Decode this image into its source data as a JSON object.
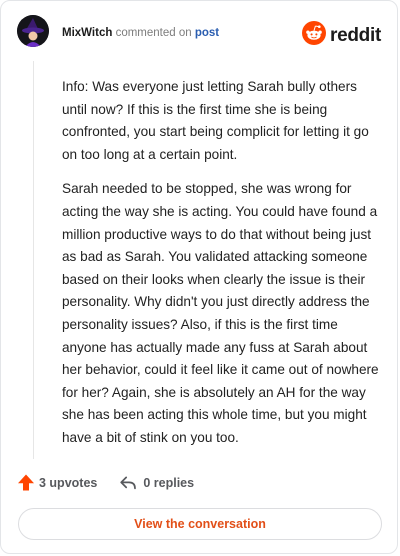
{
  "comment": {
    "username": "MixWitch",
    "action_text": "commented on",
    "target_link": "post",
    "avatar_icon": "witch-hat-avatar-icon",
    "paragraphs": [
      "Info: Was everyone just letting Sarah bully others until now? If this is the first time she is being confronted, you start being complicit for letting it go on too long at a certain point.",
      "Sarah needed to be stopped, she was wrong for acting the way she is acting. You could have found a million productive ways to do that without being just as bad as Sarah. You validated attacking someone based on their looks when clearly the issue is their personality. Why didn't you just directly address the personality issues? Also, if this is the first time anyone has actually made any fuss at Sarah about her behavior, could it feel like it came out of nowhere for her? Again, she is absolutely an AH for the way she has been acting this whole time, but you might have a bit of stink on you too."
    ]
  },
  "brand": {
    "wordmark": "reddit",
    "icon": "reddit-snoo-icon",
    "color": "#ff4500"
  },
  "footer": {
    "upvotes_label": "3 upvotes",
    "upvote_icon": "upvote-arrow-icon",
    "upvote_color": "#ff4500",
    "replies_label": "0 replies",
    "reply_icon": "reply-arrow-icon"
  },
  "cta": {
    "label": "View the conversation",
    "color": "#e24f18"
  }
}
